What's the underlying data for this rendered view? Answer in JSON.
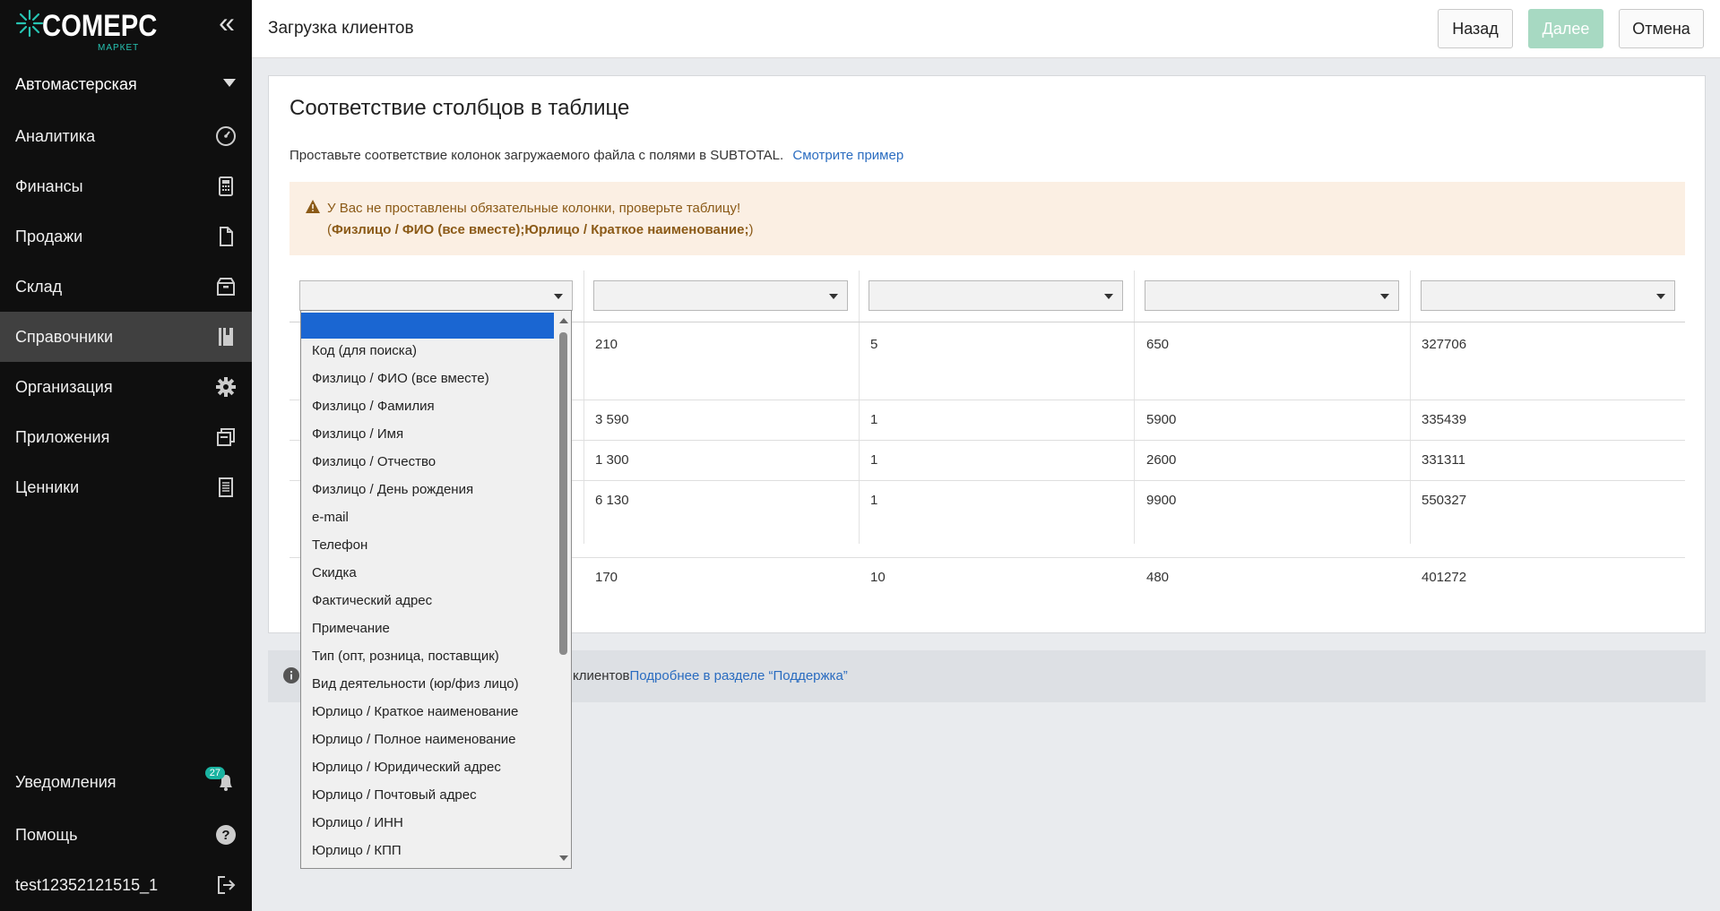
{
  "brand": {
    "name": "COMEPC",
    "sub": "МАРКЕТ",
    "accent": "#27c3b2"
  },
  "sidebar": {
    "company": "Автомастерская",
    "items": [
      {
        "label": "Аналитика",
        "icon": "gauge-icon"
      },
      {
        "label": "Финансы",
        "icon": "calculator-icon"
      },
      {
        "label": "Продажи",
        "icon": "document-icon"
      },
      {
        "label": "Склад",
        "icon": "box-icon"
      },
      {
        "label": "Справочники",
        "icon": "book-icon",
        "active": true
      },
      {
        "label": "Организация",
        "icon": "gear-icon"
      },
      {
        "label": "Приложения",
        "icon": "windows-icon"
      },
      {
        "label": "Ценники",
        "icon": "price-tag-icon"
      }
    ],
    "bottom": [
      {
        "label": "Уведомления",
        "icon": "bell-icon",
        "badge": "27"
      },
      {
        "label": "Помощь",
        "icon": "help-icon"
      },
      {
        "label": "test12352121515_1",
        "icon": "logout-icon"
      }
    ]
  },
  "header": {
    "title": "Загрузка клиентов",
    "back": "Назад",
    "next": "Далее",
    "cancel": "Отмена"
  },
  "card": {
    "title": "Соответствие столбцов в таблице",
    "description": "Проставьте соответствие колонок загружаемого файла с полями в SUBTOTAL.",
    "example_link": "Смотрите пример",
    "warning": {
      "line1": "У Вас не проставлены обязательные колонки, проверьте таблицу!",
      "open": "(",
      "bold": "Физлицо / ФИО (все вместе);Юрлицо / Краткое наименование;",
      "close": ")"
    }
  },
  "table": {
    "rows": [
      [
        "210",
        "5",
        "650",
        "327706"
      ],
      [
        "3 590",
        "1",
        "5900",
        "335439"
      ],
      [
        "1 300",
        "1",
        "2600",
        "331311"
      ],
      [
        "6 130",
        "1",
        "9900",
        "550327"
      ],
      [
        "170",
        "10",
        "480",
        "401272"
      ]
    ]
  },
  "info": {
    "text": "клиентов",
    "link": "Подробнее в разделе “Поддержка”"
  },
  "dropdown": {
    "options": [
      "Код (для поиска)",
      "Физлицо / ФИО (все вместе)",
      "Физлицо / Фамилия",
      "Физлицо / Имя",
      "Физлицо / Отчество",
      "Физлицо / День рождения",
      "e-mail",
      "Телефон",
      "Скидка",
      "Фактический адрес",
      "Примечание",
      "Тип (опт, розница, поставщик)",
      "Вид деятельности (юр/физ лицо)",
      "Юрлицо / Краткое наименование",
      "Юрлицо / Полное наименование",
      "Юрлицо / Юридический адрес",
      "Юрлицо / Почтовый адрес",
      "Юрлицо / ИНН",
      "Юрлицо / КПП"
    ]
  }
}
